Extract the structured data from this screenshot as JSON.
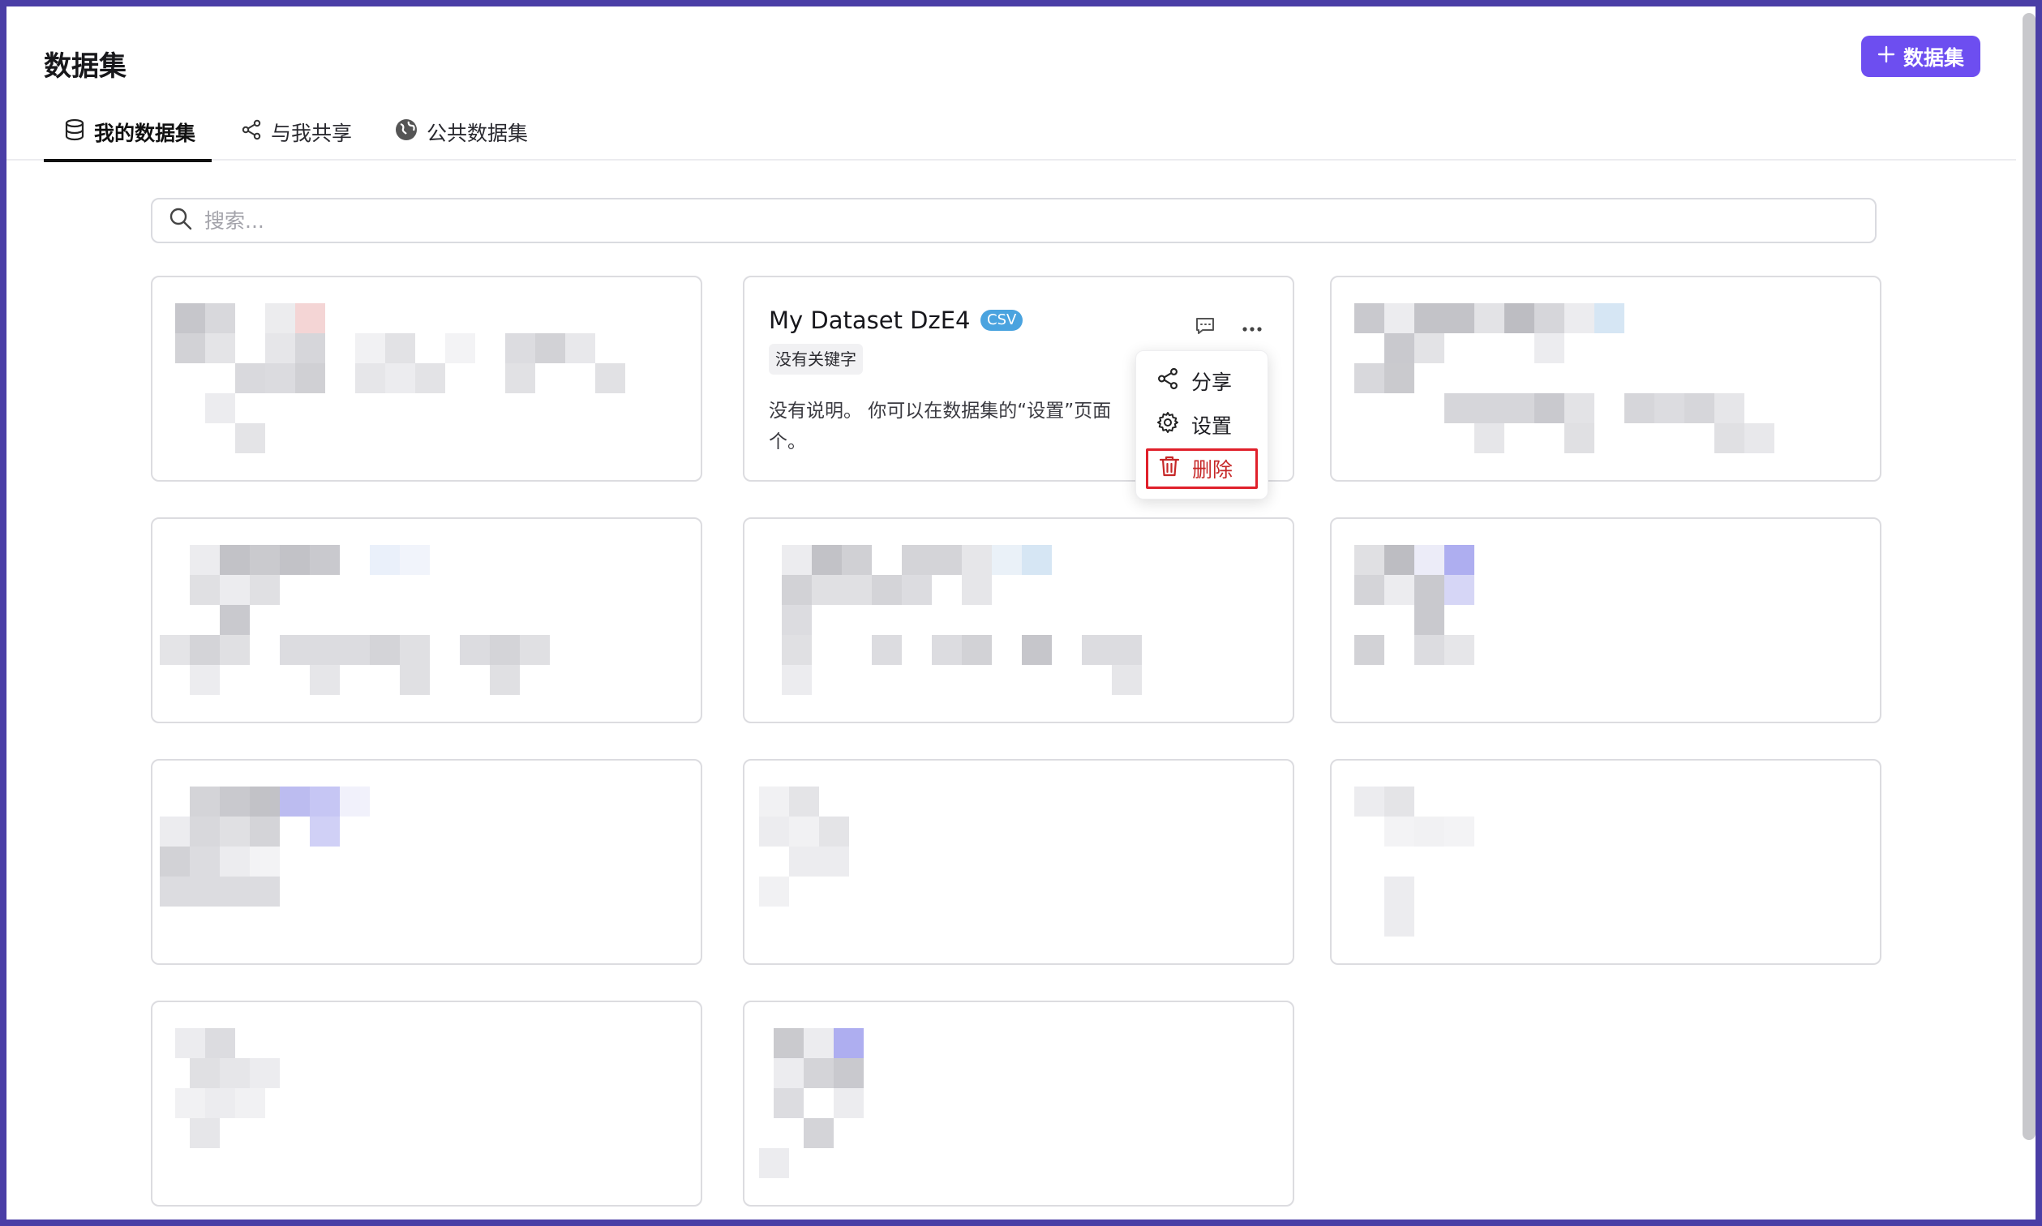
{
  "header": {
    "title": "数据集",
    "add_button_label": "数据集"
  },
  "tabs": [
    {
      "label": "我的数据集",
      "icon": "database-icon",
      "active": true
    },
    {
      "label": "与我共享",
      "icon": "share-icon",
      "active": false
    },
    {
      "label": "公共数据集",
      "icon": "globe-icon",
      "active": false
    }
  ],
  "search": {
    "placeholder": "搜索...",
    "value": ""
  },
  "featured_dataset": {
    "name": "My Dataset DzE4",
    "format": "CSV",
    "keyword": "没有关键字",
    "description": "没有说明。 你可以在数据集的“设置”页面",
    "description_wrap": "个。"
  },
  "context_menu": {
    "items": [
      {
        "label": "分享",
        "icon": "share-icon"
      },
      {
        "label": "设置",
        "icon": "gear-icon"
      },
      {
        "label": "删除",
        "icon": "trash-icon",
        "danger": true
      }
    ]
  },
  "colors": {
    "accent": "#6d4ef0",
    "danger": "#c62828",
    "badge": "#4aa3df"
  }
}
